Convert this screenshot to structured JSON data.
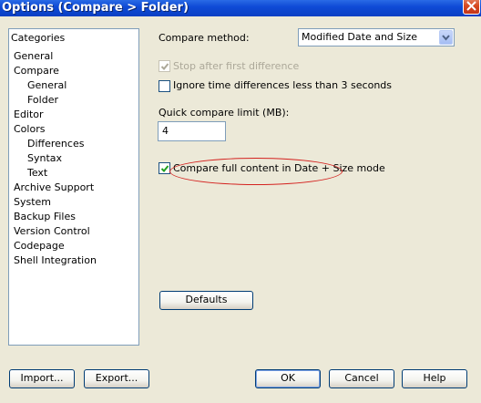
{
  "window": {
    "title": "Options (Compare > Folder)"
  },
  "categories": {
    "header": "Categories",
    "items": [
      "General",
      "Compare",
      "General",
      "Folder",
      "Editor",
      "Colors",
      "Differences",
      "Syntax",
      "Text",
      "Archive Support",
      "System",
      "Backup Files",
      "Version Control",
      "Codepage",
      "Shell Integration"
    ]
  },
  "compare": {
    "method_label": "Compare method:",
    "method_value": "Modified Date and Size",
    "stop_after_first": {
      "label": "Stop after first difference",
      "checked": true,
      "enabled": false
    },
    "ignore_time": {
      "label": "Ignore time differences less than 3 seconds",
      "checked": false
    },
    "quick_limit_label": "Quick compare limit (MB):",
    "quick_limit_value": "4",
    "full_content": {
      "label": "Compare full content in Date + Size mode",
      "checked": true
    },
    "defaults_label": "Defaults"
  },
  "buttons": {
    "import": "Import...",
    "export": "Export...",
    "ok": "OK",
    "cancel": "Cancel",
    "help": "Help"
  },
  "colors": {
    "title_bar": "#0a3fc4",
    "dialog_bg": "#ECE9D8",
    "annotation": "#d4221f",
    "checkmark": "#21a121"
  },
  "icons": [
    "close-icon",
    "chevron-down-icon",
    "checkmark-icon"
  ]
}
